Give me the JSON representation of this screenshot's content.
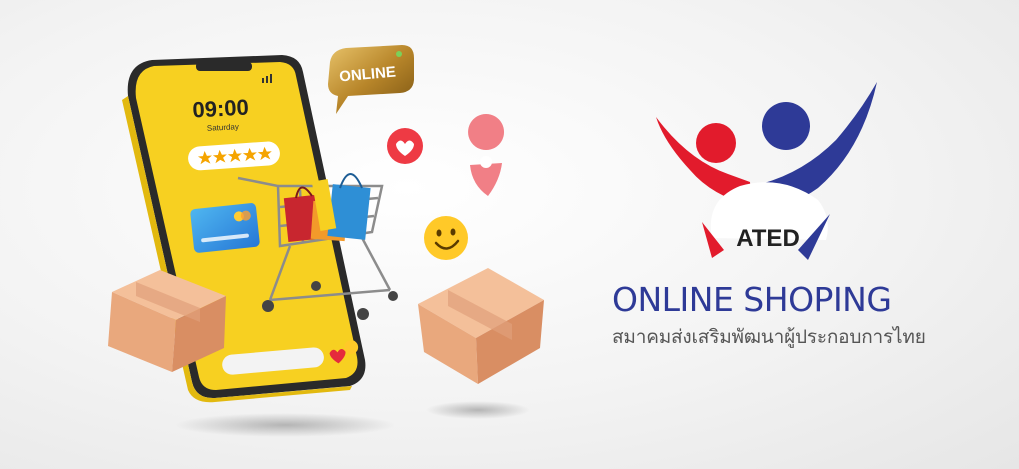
{
  "phone": {
    "time": "09:00",
    "day": "Saturday",
    "screen_color": "#f7d021"
  },
  "badge": {
    "label": "ONLINE"
  },
  "brand": {
    "logo_text": "ATED",
    "title": "ONLINE SHOPING",
    "subtitle": "สมาคมส่งเสริมพัฒนาผู้ประกอบการไทย",
    "colors": {
      "red": "#e21b2c",
      "blue": "#2e3a97"
    }
  },
  "icons": [
    "heart-icon",
    "location-pin-icon",
    "smiley-icon",
    "star-icon",
    "credit-card-icon",
    "shopping-cart-icon",
    "shopping-bag-icon",
    "box-icon"
  ]
}
